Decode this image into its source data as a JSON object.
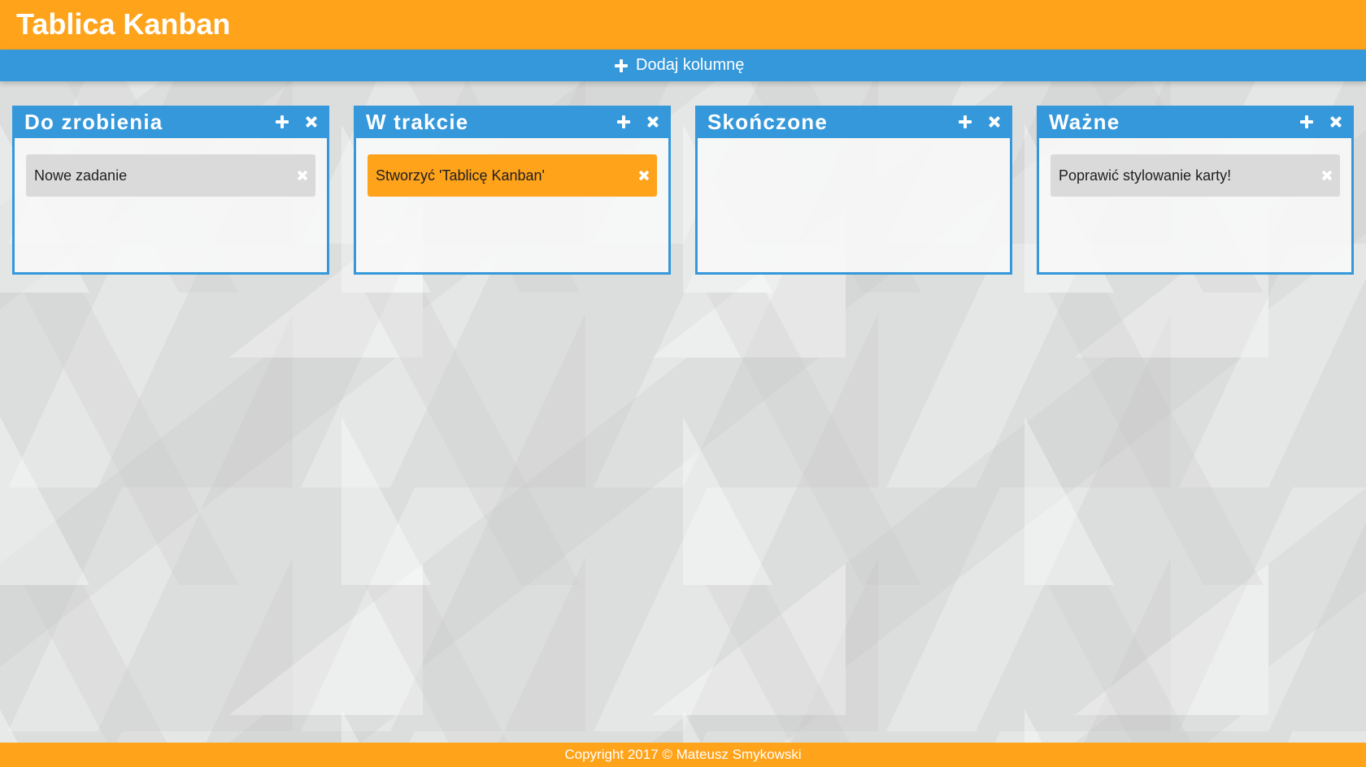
{
  "app": {
    "title": "Tablica Kanban",
    "accent_color": "#ffa31a",
    "primary_color": "#3498db"
  },
  "toolbar": {
    "add_column_label": "Dodaj kolumnę",
    "add_column_icon": "plus-icon"
  },
  "columns": [
    {
      "title": "Do zrobienia",
      "cards": [
        {
          "text": "Nowe zadanie",
          "highlighted": false
        }
      ]
    },
    {
      "title": "W trakcie",
      "cards": [
        {
          "text": "Stworzyć 'Tablicę Kanban'",
          "highlighted": true
        }
      ]
    },
    {
      "title": "Skończone",
      "cards": []
    },
    {
      "title": "Ważne",
      "cards": [
        {
          "text": "Poprawić stylowanie karty!",
          "highlighted": false
        }
      ]
    }
  ],
  "icons": {
    "add_card": "plus-icon",
    "delete_column": "close-icon",
    "delete_card": "close-icon"
  },
  "footer": {
    "copyright": "Copyright 2017 © Mateusz Smykowski"
  }
}
